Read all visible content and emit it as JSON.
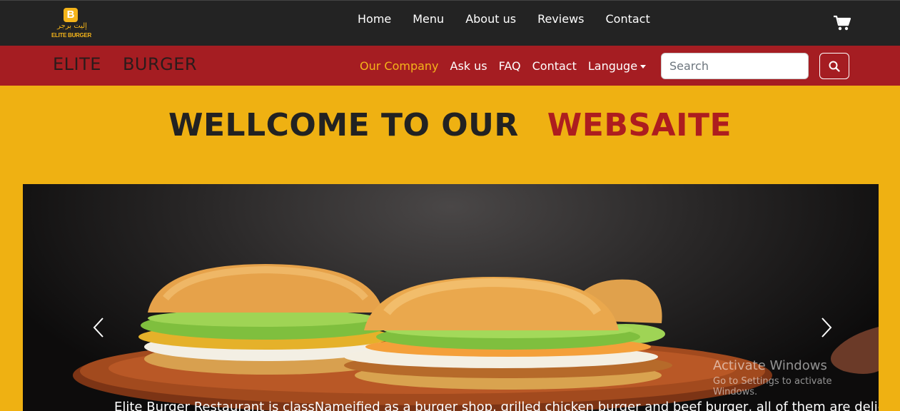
{
  "logo": {
    "letter": "B",
    "arabic": "إليت برجر",
    "english": "ELITE BURGER"
  },
  "main_nav": [
    {
      "label": "Home"
    },
    {
      "label": "Menu"
    },
    {
      "label": "About us"
    },
    {
      "label": "Reviews"
    },
    {
      "label": "Contact"
    }
  ],
  "cart_icon": "cart-icon",
  "brand": {
    "word1": "ELITE",
    "word2": "BURGER"
  },
  "sub_nav": [
    {
      "label": "Our Company",
      "active": true
    },
    {
      "label": "Ask us"
    },
    {
      "label": "FAQ"
    },
    {
      "label": "Contact"
    },
    {
      "label": "Languge",
      "dropdown": true
    }
  ],
  "search": {
    "placeholder": "Search",
    "value": "",
    "icon": "search-icon"
  },
  "welcome": {
    "text": "WELLCOME TO OUR",
    "accent": "WEBSAITE"
  },
  "carousel": {
    "caption": "Elite Burger Restaurant is classNameified as a burger shop, grilled chicken burger and beef burger, all of them are delicious",
    "prev_icon": "chevron-left-icon",
    "next_icon": "chevron-right-icon"
  },
  "watermark": {
    "line1": "Activate Windows",
    "line2": "Go to Settings to activate Windows."
  },
  "colors": {
    "topbar": "#232323",
    "redbar": "#a51d22",
    "page": "#efb112",
    "accent_red": "#ad1d1f",
    "active_link": "#f4b41a"
  }
}
